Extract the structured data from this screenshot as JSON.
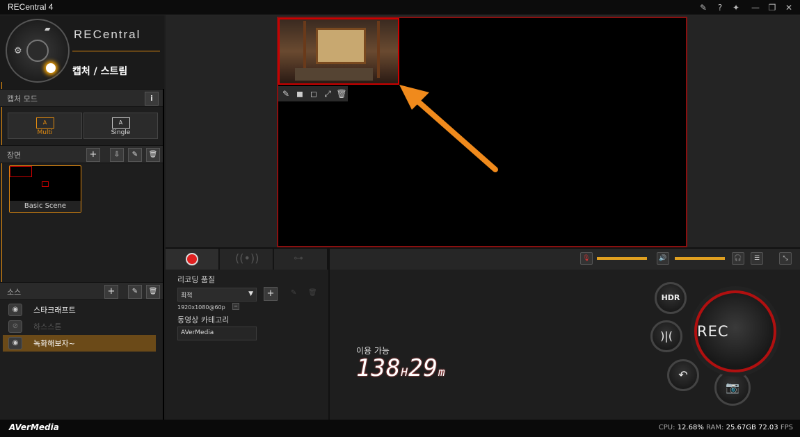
{
  "window": {
    "title": "RECentral 4"
  },
  "brand": {
    "logo_text": "RECentral",
    "mode_title": "캡처 / 스트림"
  },
  "capture_mode": {
    "label": "캡처 모드",
    "multi_label": "Multi",
    "single_label": "Single",
    "multi_icon": "A",
    "single_icon": "A"
  },
  "scenes": {
    "label": "장면",
    "items": [
      {
        "name": "Basic Scene"
      }
    ]
  },
  "sources": {
    "label": "소스",
    "items": [
      {
        "name": "스타크래프트"
      },
      {
        "name": "하스스톤"
      },
      {
        "name": "녹화해보자~"
      }
    ]
  },
  "recording": {
    "quality_label": "리코딩 품질",
    "quality_value": "최적",
    "resolution": "1920x1080@60p",
    "category_label": "동영상 카테고리",
    "category_value": "AVerMedia"
  },
  "available": {
    "label": "이용 가능",
    "hours": "138",
    "minutes": "29",
    "h_unit": "H",
    "m_unit": "m"
  },
  "rec_button": {
    "label": "REC"
  },
  "hdr_button": {
    "label": "HDR"
  },
  "status": {
    "brand": "AVerMedia",
    "cpu_label": "CPU:",
    "cpu": "12.68%",
    "ram_label": "RAM:",
    "ram": "25.67GB",
    "fps": "72.03",
    "fps_label": "FPS"
  },
  "colors": {
    "accent": "#e08a10",
    "rec_red": "#e02020",
    "arrow": "#f08a1c"
  }
}
